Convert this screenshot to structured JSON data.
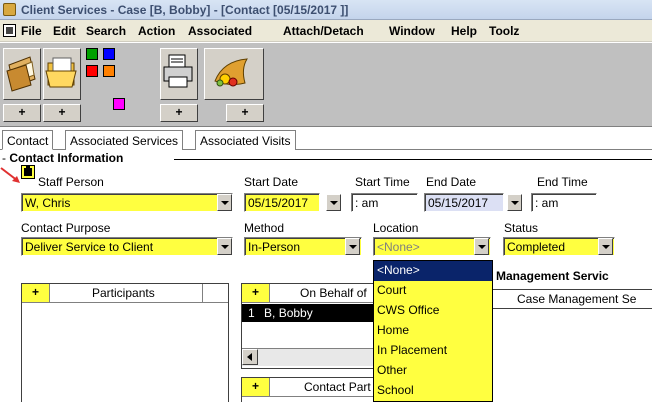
{
  "window": {
    "title": "Client Services - Case [B, Bobby] - [Contact [05/15/2017 ]]"
  },
  "menu": [
    "File",
    "Edit",
    "Search",
    "Action",
    "Associated",
    "Attach/Detach",
    "Window",
    "Help",
    "Toolz"
  ],
  "toolbar": {
    "plus": "+",
    "buttons": [
      "case-folder-icon",
      "open-folder-icon",
      "color-palette-icon",
      "printer-icon",
      "cornucopia-icon"
    ],
    "colors": [
      "#00a000",
      "#0000ff",
      "#ff0000",
      "#ff8000",
      "#ff00ff"
    ]
  },
  "tabs": [
    "Contact",
    "Associated Services",
    "Associated Visits"
  ],
  "section_title": "Contact Information",
  "form": {
    "staff_person_label": "Staff Person",
    "staff_person_value": "W, Chris",
    "start_date_label": "Start Date",
    "start_date_value": "05/15/2017",
    "start_time_label": "Start Time",
    "start_time_value": ": am",
    "end_date_label": "End Date",
    "end_date_value": "05/15/2017",
    "end_time_label": "End Time",
    "end_time_value": ": am",
    "contact_purpose_label": "Contact Purpose",
    "contact_purpose_value": "Deliver Service to Client",
    "method_label": "Method",
    "method_value": "In-Person",
    "location_label": "Location",
    "location_value": "<None>",
    "status_label": "Status",
    "status_value": "Completed"
  },
  "participants_grid": {
    "plus": "+",
    "header": "Participants"
  },
  "on_behalf_grid": {
    "plus": "+",
    "header": "On Behalf of",
    "rows": [
      {
        "num": "1",
        "name": "B, Bobby"
      }
    ]
  },
  "contact_part_grid": {
    "plus": "+",
    "header": "Contact Part"
  },
  "case_mgmt": {
    "title": "e Management Servic",
    "column": "Case Management Se"
  },
  "location_options": [
    "<None>",
    "Court",
    "CWS Office",
    "Home",
    "In Placement",
    "Other",
    "School"
  ],
  "colors": {
    "field_yellow": "#ffff40",
    "selection_blue": "#0a246a",
    "arrow_red": "#e03030"
  }
}
